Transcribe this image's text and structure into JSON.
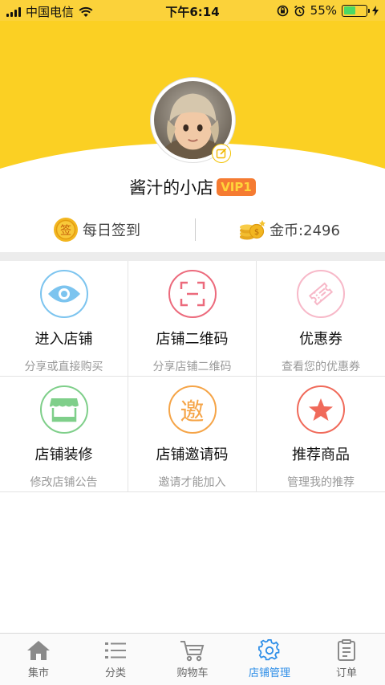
{
  "status_bar": {
    "carrier": "中国电信",
    "time": "下午6:14",
    "battery": "55%",
    "battery_level": 0.55
  },
  "profile": {
    "shop_name": "酱汁的小店",
    "vip": "VIP1"
  },
  "info": {
    "checkin": "每日签到",
    "checkin_icon_text": "签",
    "coins": "金币:2496"
  },
  "menu": [
    {
      "title": "进入店铺",
      "subtitle": "分享或直接购买",
      "icon": "eye-icon",
      "color": "#7cc4ef"
    },
    {
      "title": "店铺二维码",
      "subtitle": "分享店铺二维码",
      "icon": "qrcode-scan-icon",
      "color": "#ec6a7c"
    },
    {
      "title": "优惠券",
      "subtitle": "查看您的优惠券",
      "icon": "coupon-icon",
      "color": "#f7b8c8"
    },
    {
      "title": "店铺装修",
      "subtitle": "修改店铺公告",
      "icon": "storefront-icon",
      "color": "#7fcf8a"
    },
    {
      "title": "店铺邀请码",
      "subtitle": "邀请才能加入",
      "icon": "invite-icon",
      "icon_text": "邀",
      "color": "#f5a447"
    },
    {
      "title": "推荐商品",
      "subtitle": "管理我的推荐",
      "icon": "star-icon",
      "color": "#f06a5a"
    }
  ],
  "tabs": [
    {
      "label": "集市",
      "icon": "home-icon",
      "active": false
    },
    {
      "label": "分类",
      "icon": "list-icon",
      "active": false
    },
    {
      "label": "购物车",
      "icon": "cart-icon",
      "active": false
    },
    {
      "label": "店铺管理",
      "icon": "gear-icon",
      "active": true
    },
    {
      "label": "订单",
      "icon": "order-icon",
      "active": false
    }
  ],
  "colors": {
    "header": "#fbd023",
    "vip_bg": "#f57b32",
    "active_tab": "#2f8fe8"
  }
}
